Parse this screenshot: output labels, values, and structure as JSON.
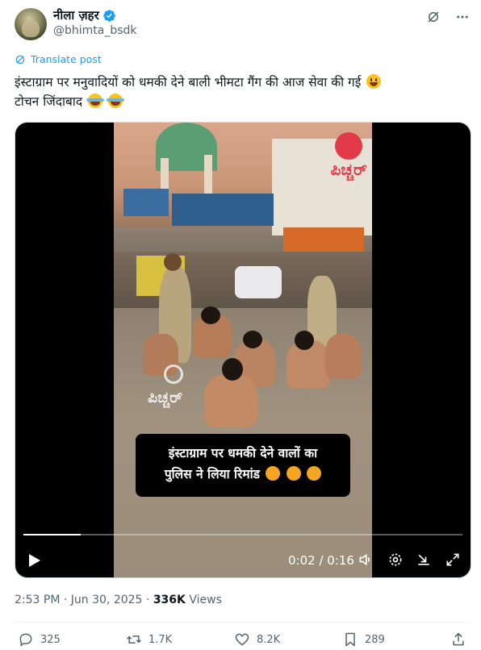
{
  "header": {
    "display_name": "नीला ज़हर",
    "handle": "@bhimta_bsdk",
    "icons": [
      "verified-badge-icon",
      "grok-icon",
      "more-icon"
    ]
  },
  "translate": {
    "label": "Translate post"
  },
  "tweet": {
    "line1": "इंस्टाग्राम पर मनुवादियों को धमकी देने बाली भीमटा गैंग की आज सेवा की गई",
    "line2": "टोचन जिंदाबाद"
  },
  "video": {
    "caption_line1": "इंस्टाग्राम पर धमकी देने वालों का",
    "caption_line2": "पुलिस ने लिया रिमांड",
    "logo_text": "ಪಿಚ್ಚರ್",
    "watermark_text": "ಪಿಚ್ಚರ್",
    "time": "0:02 / 0:16",
    "progress_fraction": 0.13
  },
  "meta": {
    "time": "2:53 PM",
    "date": "Jun 30, 2025",
    "views_count": "336K",
    "views_label": "Views"
  },
  "actions": {
    "replies": "325",
    "reposts": "1.7K",
    "likes": "8.2K",
    "bookmarks": "289"
  },
  "colors": {
    "link": "#1d9bf0",
    "muted": "#536471",
    "text": "#0f1419"
  }
}
